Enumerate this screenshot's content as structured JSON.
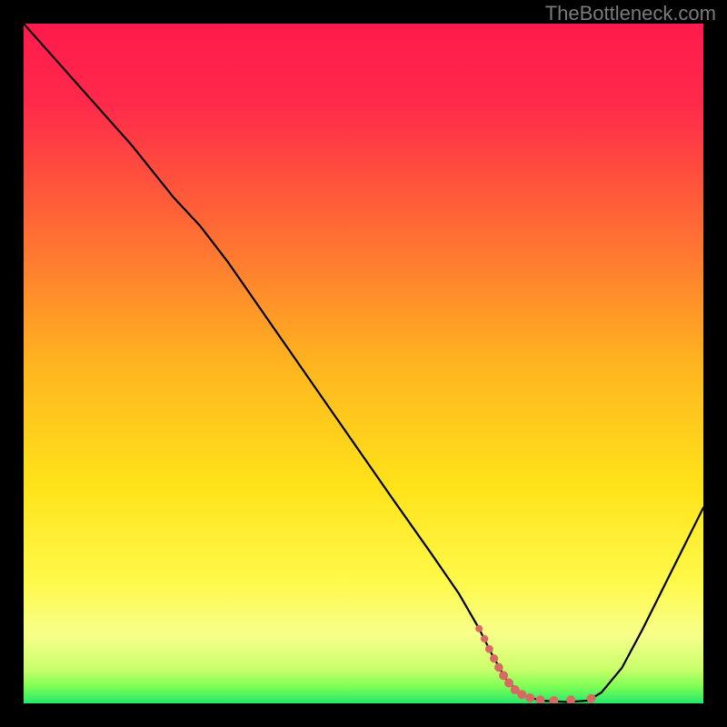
{
  "watermark": "TheBottleneck.com",
  "chart_data": {
    "type": "line",
    "title": "",
    "xlabel": "",
    "ylabel": "",
    "xlim": [
      0,
      100
    ],
    "ylim": [
      0,
      100
    ],
    "grid": false,
    "gradient_stops": [
      {
        "offset": 0.0,
        "color": "#ff1a4d"
      },
      {
        "offset": 0.12,
        "color": "#ff2a4a"
      },
      {
        "offset": 0.3,
        "color": "#ff6a35"
      },
      {
        "offset": 0.5,
        "color": "#ffb41f"
      },
      {
        "offset": 0.68,
        "color": "#ffe31a"
      },
      {
        "offset": 0.82,
        "color": "#fff94a"
      },
      {
        "offset": 0.9,
        "color": "#f7ff8a"
      },
      {
        "offset": 0.95,
        "color": "#c9ff6a"
      },
      {
        "offset": 0.975,
        "color": "#7fff55"
      },
      {
        "offset": 1.0,
        "color": "#25e86b"
      }
    ],
    "series": [
      {
        "name": "bottleneck-curve",
        "stroke": "#000000",
        "stroke_width": 2.2,
        "points": [
          {
            "x": 0.0,
            "y": 100.0
          },
          {
            "x": 8.0,
            "y": 91.0
          },
          {
            "x": 16.0,
            "y": 82.0
          },
          {
            "x": 22.0,
            "y": 74.5
          },
          {
            "x": 26.0,
            "y": 70.2
          },
          {
            "x": 30.0,
            "y": 65.0
          },
          {
            "x": 38.0,
            "y": 53.5
          },
          {
            "x": 46.0,
            "y": 42.0
          },
          {
            "x": 54.0,
            "y": 30.5
          },
          {
            "x": 60.0,
            "y": 22.0
          },
          {
            "x": 64.0,
            "y": 16.2
          },
          {
            "x": 67.0,
            "y": 11.0
          },
          {
            "x": 69.0,
            "y": 7.0
          },
          {
            "x": 71.0,
            "y": 3.5
          },
          {
            "x": 73.0,
            "y": 1.4
          },
          {
            "x": 76.0,
            "y": 0.4
          },
          {
            "x": 80.0,
            "y": 0.2
          },
          {
            "x": 83.0,
            "y": 0.4
          },
          {
            "x": 85.0,
            "y": 1.6
          },
          {
            "x": 88.0,
            "y": 5.2
          },
          {
            "x": 91.0,
            "y": 10.8
          },
          {
            "x": 94.0,
            "y": 16.8
          },
          {
            "x": 97.0,
            "y": 22.8
          },
          {
            "x": 100.0,
            "y": 28.8
          }
        ]
      },
      {
        "name": "optimal-zone-markers",
        "type": "scatter",
        "stroke": "#d96a63",
        "fill": "#d96a63",
        "points": [
          {
            "x": 67.0,
            "y": 11.0,
            "r": 4.0
          },
          {
            "x": 67.8,
            "y": 9.5,
            "r": 4.2
          },
          {
            "x": 68.5,
            "y": 8.0,
            "r": 4.4
          },
          {
            "x": 69.2,
            "y": 6.6,
            "r": 4.6
          },
          {
            "x": 69.9,
            "y": 5.3,
            "r": 4.8
          },
          {
            "x": 70.6,
            "y": 4.1,
            "r": 5.0
          },
          {
            "x": 71.4,
            "y": 3.0,
            "r": 5.0
          },
          {
            "x": 72.3,
            "y": 2.0,
            "r": 5.0
          },
          {
            "x": 73.3,
            "y": 1.3,
            "r": 5.0
          },
          {
            "x": 74.5,
            "y": 0.8,
            "r": 5.0
          },
          {
            "x": 76.0,
            "y": 0.5,
            "r": 5.0
          },
          {
            "x": 78.0,
            "y": 0.4,
            "r": 5.0
          },
          {
            "x": 80.5,
            "y": 0.5,
            "r": 5.0
          },
          {
            "x": 83.5,
            "y": 0.7,
            "r": 5.0
          }
        ]
      }
    ]
  }
}
